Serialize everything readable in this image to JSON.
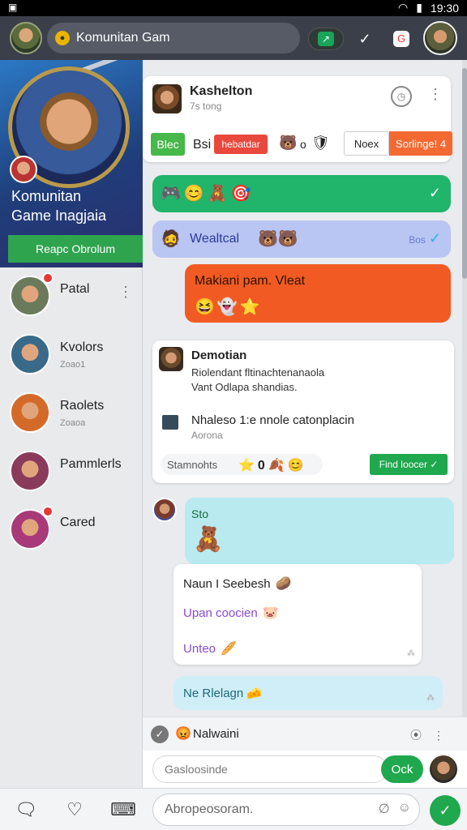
{
  "statusbar": {
    "time": "19:30",
    "left_icon": "app-icon",
    "wifi_icon": "wifi-icon",
    "battery_icon": "battery-icon"
  },
  "topbar": {
    "search_text": "Komunitan Gam",
    "icons": [
      "share-icon",
      "check-icon",
      "notification-icon"
    ]
  },
  "sidebar": {
    "hero": {
      "title_line1": "Komunitan",
      "title_line2": "Game Inagjaia",
      "join_label": "Reapc Obrolum"
    },
    "contacts": [
      {
        "name": "Patal",
        "sub": "",
        "badge": true,
        "more": "⋮",
        "color": "#6a7a5a"
      },
      {
        "name": "Kvolors",
        "sub": "Zoao1",
        "badge": false,
        "more": "",
        "color": "#3a6a8a"
      },
      {
        "name": "Raolets",
        "sub": "Zoaoa",
        "badge": false,
        "more": "",
        "color": "#d46a2a"
      },
      {
        "name": "Pammlerls",
        "sub": "",
        "badge": false,
        "more": "",
        "color": "#8a3a5a"
      },
      {
        "name": "Cared",
        "sub": "",
        "badge": true,
        "more": "",
        "color": "#a83a7a"
      }
    ]
  },
  "main": {
    "card1": {
      "name": "Kashelton",
      "sub": "7s tong",
      "chip_green": "Blec",
      "label": "Bsi",
      "chip_red": "hebatdar",
      "num": "o",
      "btn_outline": "Noex",
      "btn_orange": "Sorlinge! 4"
    },
    "bubble_lav": {
      "text": "Wealtcal",
      "tick_label": "Bos"
    },
    "bubble_orange": {
      "text": "Makiani pam. Vleat"
    },
    "card2": {
      "name": "Demotian",
      "line1": "Riolendant fltinachtenanaola",
      "line2": "Vant Odlapa shandias.",
      "attach_title": "Nhaleso 1:e nnole catonplacin",
      "attach_sub": "Aorona",
      "footer_text": "Stamnohts",
      "footer_num": "0",
      "find_button": "Find loocer"
    },
    "bubble_aqua": {
      "text": "Sto"
    },
    "card3": {
      "row1": "Naun I Seebesh",
      "row2": "Upan coocien",
      "row3": "Unteo",
      "tick": "⁂"
    },
    "bubble_light": {
      "text": "Rlelagn",
      "prefix": "Ne"
    },
    "message_head": {
      "text": "Nalwaini"
    },
    "input_row": {
      "placeholder": "Gasloosinde",
      "ok_label": "Ock"
    }
  },
  "bottom_nav": {
    "composer_placeholder": "Abropeosoram."
  }
}
